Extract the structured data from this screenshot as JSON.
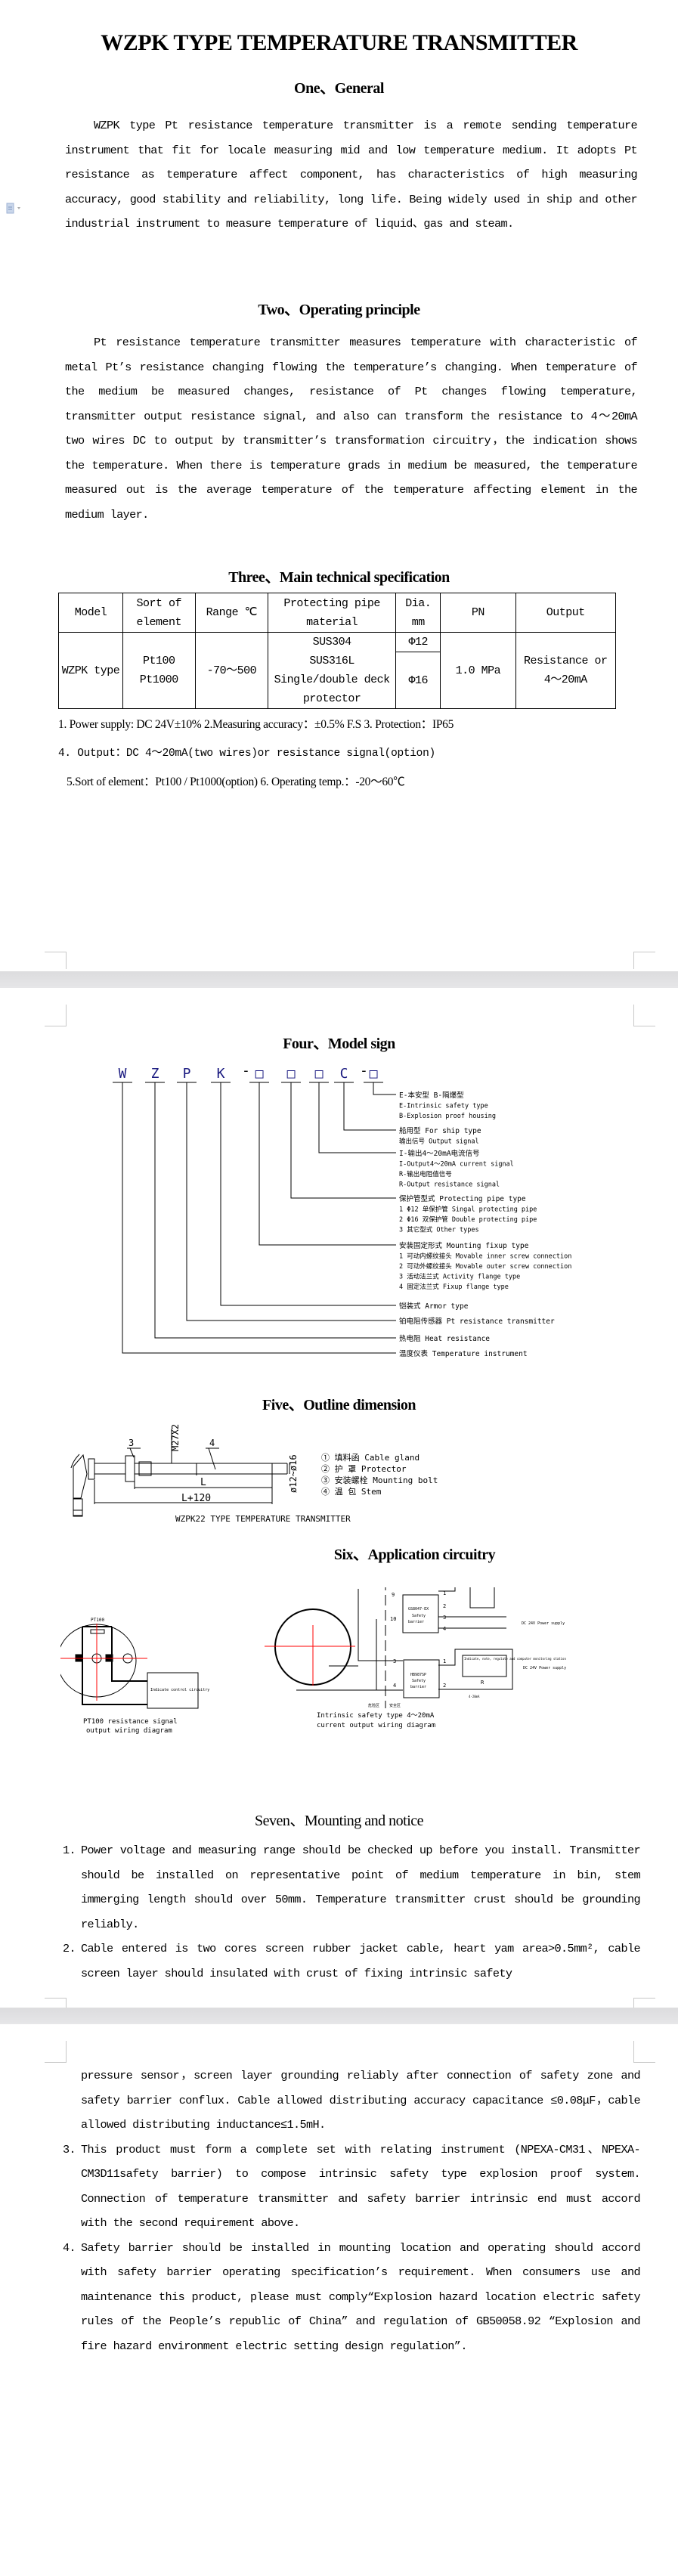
{
  "document": {
    "title": "WZPK TYPE TEMPERATURE TRANSMITTER",
    "margin_icon": "document-icon"
  },
  "section1": {
    "heading": "One、General",
    "paragraph": "WZPK type Pt resistance temperature transmitter is a remote sending temperature instrument that fit for locale measuring mid and low temperature medium. It adopts Pt resistance as temperature affect component, has characteristics of high measuring accuracy, good stability and reliability, long life. Being widely used in ship and other industrial instrument to measure temperature of liquid、gas and steam."
  },
  "section2": {
    "heading": "Two、Operating principle",
    "paragraph": "Pt resistance temperature transmitter measures temperature with characteristic of metal Pt’s resistance changing flowing the temperature’s changing. When temperature of the medium be measured changes, resistance of Pt changes flowing temperature, transmitter output resistance signal, and also can transform the resistance to 4～20mA two wires DC to output by transmitter’s transformation circuitry，the indication shows the temperature. When there is temperature grads in medium be measured, the temperature measured out is the average temperature of the temperature affecting element in the medium layer."
  },
  "section3": {
    "heading": "Three、Main technical specification",
    "table": {
      "headers": [
        "Model",
        "Sort of element",
        "Range ℃",
        "Protecting pipe material",
        "Dia. mm",
        "PN",
        "Output"
      ],
      "row": {
        "model": "WZPK type",
        "element": "Pt100 Pt1000",
        "range": "-70～500",
        "material": [
          "SUS304",
          "SUS316L",
          "Single/double deck protector"
        ],
        "dia": [
          "Φ12",
          "Φ16"
        ],
        "pn": "1.0 MPa",
        "output": "Resistance or 4～20mA"
      }
    },
    "notes": [
      "1.  Power supply:  DC 24V±10%   2.Measuring accuracy：±0.5% F.S   3. Protection：IP65",
      "4. Output：DC 4～20mA(two wires)or resistance signal(option)",
      "5.Sort of element：Pt100 / Pt1000(option) 6. Operating temp.：-20～60℃"
    ]
  },
  "section4": {
    "heading": "Four、Model sign",
    "code_chars": [
      "W",
      "Z",
      "P",
      "K",
      "-",
      "□",
      "□",
      "□",
      "C",
      "-",
      "□"
    ],
    "legend": [
      [
        "E-本安型  B-隔爆型",
        "E-Intrinsic safety type",
        "B-Explosion proof housing"
      ],
      [
        "船用型 For ship type",
        "输出信号 Output signal"
      ],
      [
        "I-输出4～20mA电流信号",
        "I-Output4～20mA current signal",
        "R-输出电阻值信号",
        "R-Output resistance signal"
      ],
      [
        "保护管型式 Protecting pipe type",
        "1 Φ12 单保护管 Singal protecting pipe",
        "2 Φ16 双保护管 Double protecting pipe",
        "3  其它型式      Other types"
      ],
      [
        "安装固定形式 Mounting fixup type",
        "1 可动内螺纹接头 Movable inner screw connection",
        "2 可动外螺纹接头 Movable outer screw connection",
        "3 活动法兰式 Activity flange type",
        "4 固定法兰式 Fixup flange type"
      ],
      [
        "铠装式 Armor type"
      ],
      [
        "铂电阻传感器 Pt resistance transmitter"
      ],
      [
        "热电阻 Heat resistance"
      ],
      [
        "温度仪表 Temperature instrument"
      ]
    ],
    "code_color": "#1a1a80",
    "underline_color": "#000000"
  },
  "section5": {
    "heading": "Five、Outline dimension",
    "labels": {
      "thread": "M27X2",
      "callout3": "3",
      "callout4": "4",
      "dim_L": "L",
      "dim_L120": "L+120",
      "dia": "ø12~ø16"
    },
    "parts": [
      "① 填料函 Cable gland",
      "② 护  罩 Protector",
      "③ 安装螺栓 Mounting bolt",
      "④ 温  包 Stem"
    ],
    "caption": "WZPK22 TYPE TEMPERATURE TRANSMITTER"
  },
  "section6": {
    "heading": "Six、Application circuitry",
    "left_diagram": {
      "sensor_label": "PT100",
      "box_label": "Indicate control circuitry",
      "caption_line1": "PT100 resistance signal",
      "caption_line2": "output wiring diagram"
    },
    "right_diagram": {
      "barrier1": [
        "GS8047-EX",
        "Safety",
        "barrier"
      ],
      "barrier2": [
        "HB987SP",
        "Safety",
        "barrier"
      ],
      "terminals_left_top": [
        "9",
        "10"
      ],
      "terminals_right_top": [
        "1",
        "2",
        "3",
        "4"
      ],
      "terminals_left_bottom": [
        "3",
        "4"
      ],
      "terminals_right_bottom": [
        "1",
        "2"
      ],
      "indicator1": "Indicate, note, regulate and computer monitoring",
      "indicator2": "Indicate, note, regulate and computer monitoring station",
      "resistor": "R",
      "current": "4-20mA",
      "power": "DC 24V  Power supply",
      "hazard_zone": "危险区",
      "safe_zone": "安全区",
      "plus": "+",
      "minus": "−",
      "caption_line1": "Intrinsic safety type 4～20mA",
      "caption_line2": "current output wiring diagram"
    }
  },
  "section7": {
    "heading": "Seven、Mounting and notice",
    "items": [
      {
        "num": "1.",
        "text": "Power voltage and measuring range should be checked up before you install. Transmitter should be installed on representative point of medium temperature in bin, stem immerging length should over 50mm. Temperature transmitter crust should be grounding reliably."
      },
      {
        "num": "2.",
        "text_a": "Cable entered is two cores screen rubber jacket cable, heart yam area>0.5mm², cable screen layer should insulated with crust of fixing intrinsic safety",
        "text_b": "pressure sensor，screen layer grounding reliably after connection of safety zone and safety barrier conflux. Cable allowed distributing accuracy capacitance ≤0.08μF，cable allowed distributing inductance≤1.5mH."
      },
      {
        "num": "3.",
        "text": "This product must form a complete set with relating instrument (NPEXA-CM31、NPEXA-CM3D11safety barrier) to compose intrinsic safety type explosion proof system. Connection of temperature transmitter and safety barrier intrinsic end must accord with the second requirement above."
      },
      {
        "num": "4.",
        "text": "Safety barrier should be installed in mounting location and operating should accord with safety barrier operating specification’s requirement. When consumers use and maintenance this product, please must comply“Explosion hazard location electric safety rules of the People’s republic of China” and regulation of GB50058.92 “Explosion and fire hazard environment electric setting design regulation”."
      }
    ]
  }
}
